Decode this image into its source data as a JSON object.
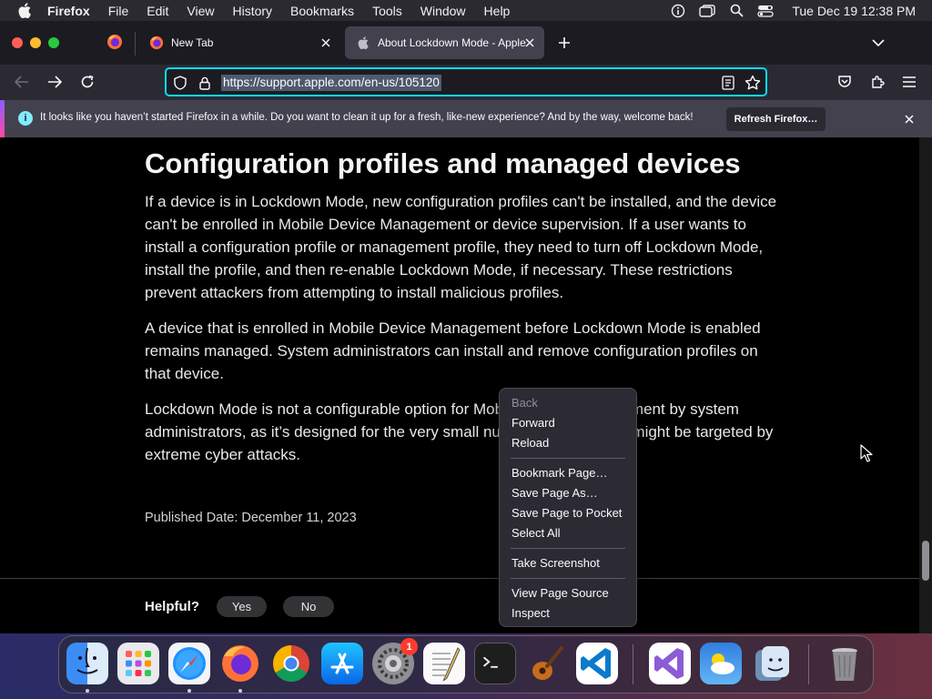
{
  "menubar": {
    "app_name": "Firefox",
    "items": [
      "File",
      "Edit",
      "View",
      "History",
      "Bookmarks",
      "Tools",
      "Window",
      "Help"
    ],
    "clock": "Tue Dec 19  12:38 PM"
  },
  "tabs": {
    "newtab_label": "New Tab",
    "active_label": "About Lockdown Mode - Apple Su"
  },
  "navbar": {
    "url": "https://support.apple.com/en-us/105120"
  },
  "notification": {
    "message": "It looks like you haven’t started Firefox in a while. Do you want to clean it up for a fresh, like-new experience? And by the way, welcome back!",
    "button_label": "Refresh Firefox…"
  },
  "article": {
    "heading": "Configuration profiles and managed devices",
    "paragraphs": [
      "If a device is in Lockdown Mode, new configuration profiles can't be installed, and the device can't be enrolled in Mobile Device Management or device supervision. If a user wants to install a configuration profile or management profile, they need to turn off Lockdown Mode, install the profile, and then re-enable Lockdown Mode, if necessary. These restrictions prevent attackers from attempting to install malicious profiles.",
      "A device that is enrolled in Mobile Device Management before Lockdown Mode is enabled remains managed. System administrators can install and remove configuration profiles on that device.",
      "Lockdown Mode is not a configurable option for Mobile Device Management by system administrators, as it’s designed for the very small number of users who might be targeted by extreme cyber attacks."
    ],
    "published": "Published Date: December 11, 2023"
  },
  "feedback": {
    "label": "Helpful?",
    "yes": "Yes",
    "no": "No"
  },
  "context_menu": {
    "items": [
      {
        "label": "Back",
        "disabled": true
      },
      {
        "label": "Forward"
      },
      {
        "label": "Reload"
      },
      {
        "label": "Bookmark Page…"
      },
      {
        "label": "Save Page As…"
      },
      {
        "label": "Save Page to Pocket"
      },
      {
        "label": "Select All"
      },
      {
        "label": "Take Screenshot"
      },
      {
        "label": "View Page Source"
      },
      {
        "label": "Inspect"
      }
    ]
  },
  "dock": {
    "apps": [
      "finder",
      "launchpad",
      "safari",
      "firefox",
      "chrome",
      "app-store",
      "system-settings",
      "textedit",
      "terminal",
      "garageband",
      "vscode",
      "visual-studio",
      "weather",
      "migration-assistant",
      "trash"
    ],
    "system_settings_badge": "1"
  },
  "colors": {
    "accent": "#00ddff",
    "page_bg": "#000000",
    "toolbar_bg": "#2b2a33"
  }
}
